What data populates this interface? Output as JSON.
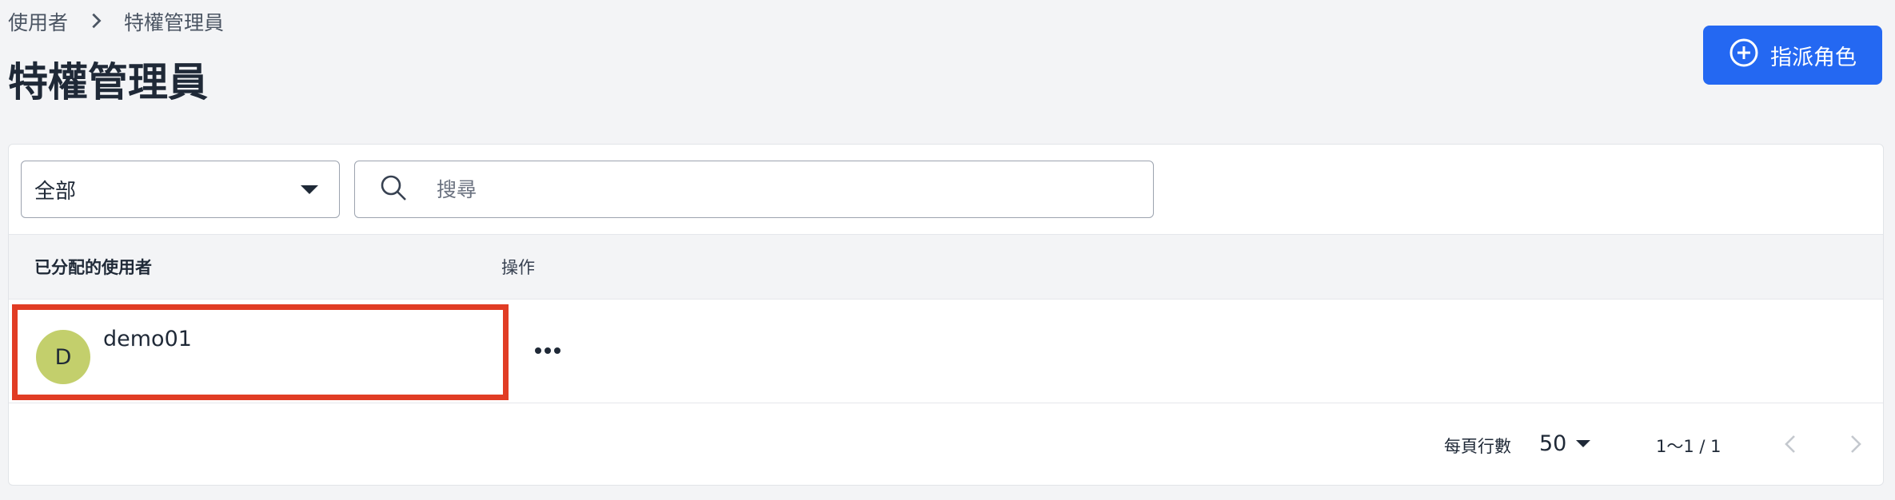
{
  "breadcrumb": {
    "parent": "使用者",
    "current": "特權管理員"
  },
  "page": {
    "title": "特權管理員"
  },
  "actions": {
    "assign_role_label": "指派角色"
  },
  "filter": {
    "selected": "全部"
  },
  "search": {
    "placeholder": "搜尋"
  },
  "table": {
    "columns": {
      "user": "已分配的使用者",
      "actions": "操作"
    },
    "rows": [
      {
        "avatar_initial": "D",
        "username": "demo01"
      }
    ]
  },
  "pagination": {
    "rows_per_page_label": "每頁行數",
    "rows_per_page": "50",
    "range": "1〜1 / 1"
  },
  "colors": {
    "primary": "#2468f2",
    "avatar": "#c3cf6c",
    "highlight": "#e13c24"
  },
  "icons": [
    "chevron-right-icon",
    "plus-circle-icon",
    "caret-down-icon",
    "search-icon",
    "more-horizontal-icon",
    "chevron-left-icon"
  ]
}
